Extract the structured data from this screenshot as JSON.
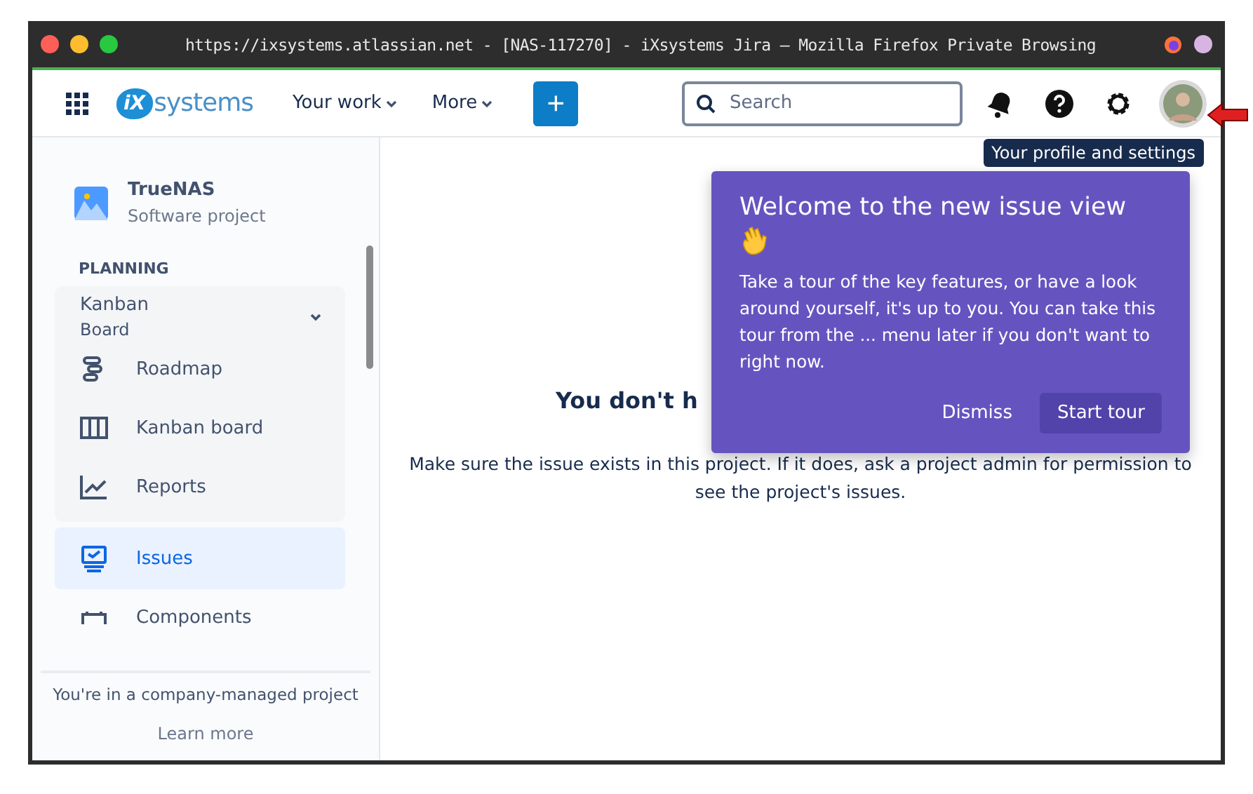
{
  "window": {
    "title": "https://ixsystems.atlassian.net - [NAS-117270] - iXsystems Jira — Mozilla Firefox Private Browsing"
  },
  "nav": {
    "logo_mark": "iX",
    "logo_text": "systems",
    "menus": [
      {
        "label": "Your work"
      },
      {
        "label": "More"
      }
    ],
    "create": "+",
    "search": {
      "placeholder": "Search"
    },
    "tooltip": "Your profile and settings"
  },
  "sidebar": {
    "project": {
      "name": "TrueNAS",
      "type": "Software project"
    },
    "section": "PLANNING",
    "group": {
      "label": "Kanban",
      "sublabel": "Board",
      "expanded": true,
      "items": [
        {
          "label": "Roadmap",
          "selected": false
        },
        {
          "label": "Kanban board",
          "selected": false
        },
        {
          "label": "Reports",
          "selected": false
        }
      ]
    },
    "items": [
      {
        "label": "Issues",
        "selected": true
      },
      {
        "label": "Components",
        "selected": false
      }
    ],
    "footer": {
      "text": "You're in a company-managed project",
      "link": "Learn more"
    }
  },
  "main": {
    "heading": "You don't h",
    "message": "Make sure the issue exists in this project. If it does, ask a project admin for permission to see the project's issues."
  },
  "popup": {
    "title": "Welcome to the new issue view",
    "body": "Take a tour of the key features, or have a look around yourself, it's up to you. You can take this tour from the ... menu later if you don't want to right now.",
    "buttons": [
      {
        "label": "Dismiss",
        "primary": false
      },
      {
        "label": "Start tour",
        "primary": true
      }
    ]
  }
}
